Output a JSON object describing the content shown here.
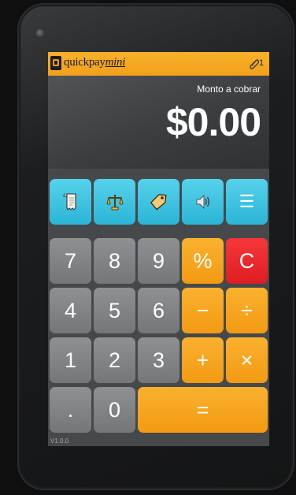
{
  "app": {
    "brand_prefix": "quickpay",
    "brand_suffix": "mini",
    "attachment_count": "1"
  },
  "display": {
    "label": "Monto a cobrar",
    "amount": "$0.00"
  },
  "function_keys": [
    {
      "name": "receipt-button",
      "icon": "receipt-icon"
    },
    {
      "name": "scale-button",
      "icon": "scale-icon"
    },
    {
      "name": "tag-button",
      "icon": "tag-icon"
    },
    {
      "name": "sound-button",
      "icon": "speaker-icon"
    },
    {
      "name": "menu-button",
      "icon": "menu-icon",
      "label": "☰"
    }
  ],
  "keys": {
    "seven": "7",
    "eight": "8",
    "nine": "9",
    "percent": "%",
    "clear": "C",
    "four": "4",
    "five": "5",
    "six": "6",
    "minus": "−",
    "divide": "÷",
    "one": "1",
    "two": "2",
    "three": "3",
    "plus": "+",
    "multiply": "×",
    "dot": ".",
    "zero": "0",
    "equals": "="
  },
  "footer": {
    "version": "V1.0.0"
  },
  "colors": {
    "accent_orange": "#f39a12",
    "teal": "#2bb5d6",
    "gray_key": "#74777a",
    "clear_red": "#de1d22"
  }
}
